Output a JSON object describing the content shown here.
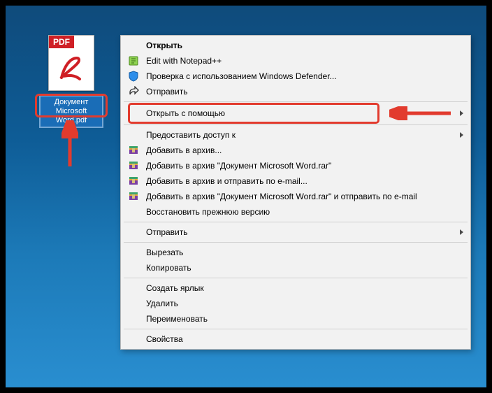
{
  "file": {
    "badge": "PDF",
    "label": "Документ Microsoft Word.pdf"
  },
  "menu": {
    "open": "Открыть",
    "edit_notepadpp": "Edit with Notepad++",
    "defender": "Проверка с использованием Windows Defender...",
    "send_partial": "Отправить",
    "open_with": "Открыть с помощью",
    "share_access": "Предоставить доступ к",
    "rar_add": "Добавить в архив...",
    "rar_add_named": "Добавить в архив \"Документ Microsoft Word.rar\"",
    "rar_add_send": "Добавить в архив и отправить по e-mail...",
    "rar_add_named_send": "Добавить в архив \"Документ Microsoft Word.rar\" и отправить по e-mail",
    "restore_prev": "Восстановить прежнюю версию",
    "send_to": "Отправить",
    "cut": "Вырезать",
    "copy": "Копировать",
    "create_shortcut": "Создать ярлык",
    "delete": "Удалить",
    "rename": "Переименовать",
    "properties": "Свойства"
  }
}
